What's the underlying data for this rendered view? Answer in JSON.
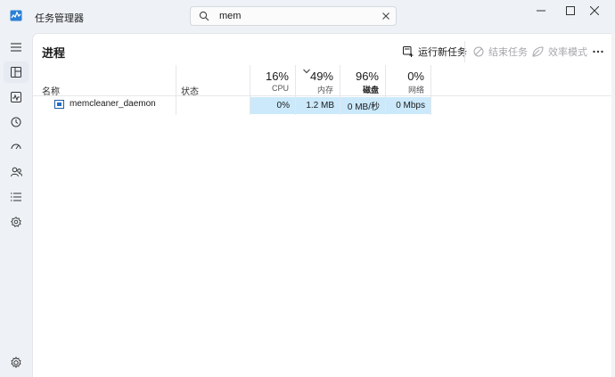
{
  "window": {
    "title": "任务管理器"
  },
  "search": {
    "value": "mem"
  },
  "page": {
    "title": "进程"
  },
  "toolbar": {
    "run_new_task": "运行新任务",
    "end_task": "结束任务",
    "efficiency_mode": "效率模式"
  },
  "table": {
    "columns": {
      "name": "名称",
      "status": "状态",
      "cpu": {
        "percent": "16%",
        "label": "CPU"
      },
      "memory": {
        "percent": "49%",
        "label": "内存"
      },
      "disk": {
        "percent": "96%",
        "label": "磁盘"
      },
      "network": {
        "percent": "0%",
        "label": "网络"
      }
    },
    "rows": [
      {
        "name": "memcleaner_daemon",
        "status": "",
        "cpu": "0%",
        "memory": "1.2 MB",
        "disk": "0 MB/秒",
        "network": "0 Mbps"
      }
    ]
  },
  "icons": {
    "nav": [
      "menu-icon",
      "processes-icon",
      "performance-icon",
      "app-history-icon",
      "startup-apps-icon",
      "users-icon",
      "details-icon",
      "services-icon",
      "settings-icon"
    ]
  },
  "colors": {
    "accent": "#0067c0",
    "highlight_cell": "#cbe9fb",
    "frame": "#eef1f6"
  }
}
